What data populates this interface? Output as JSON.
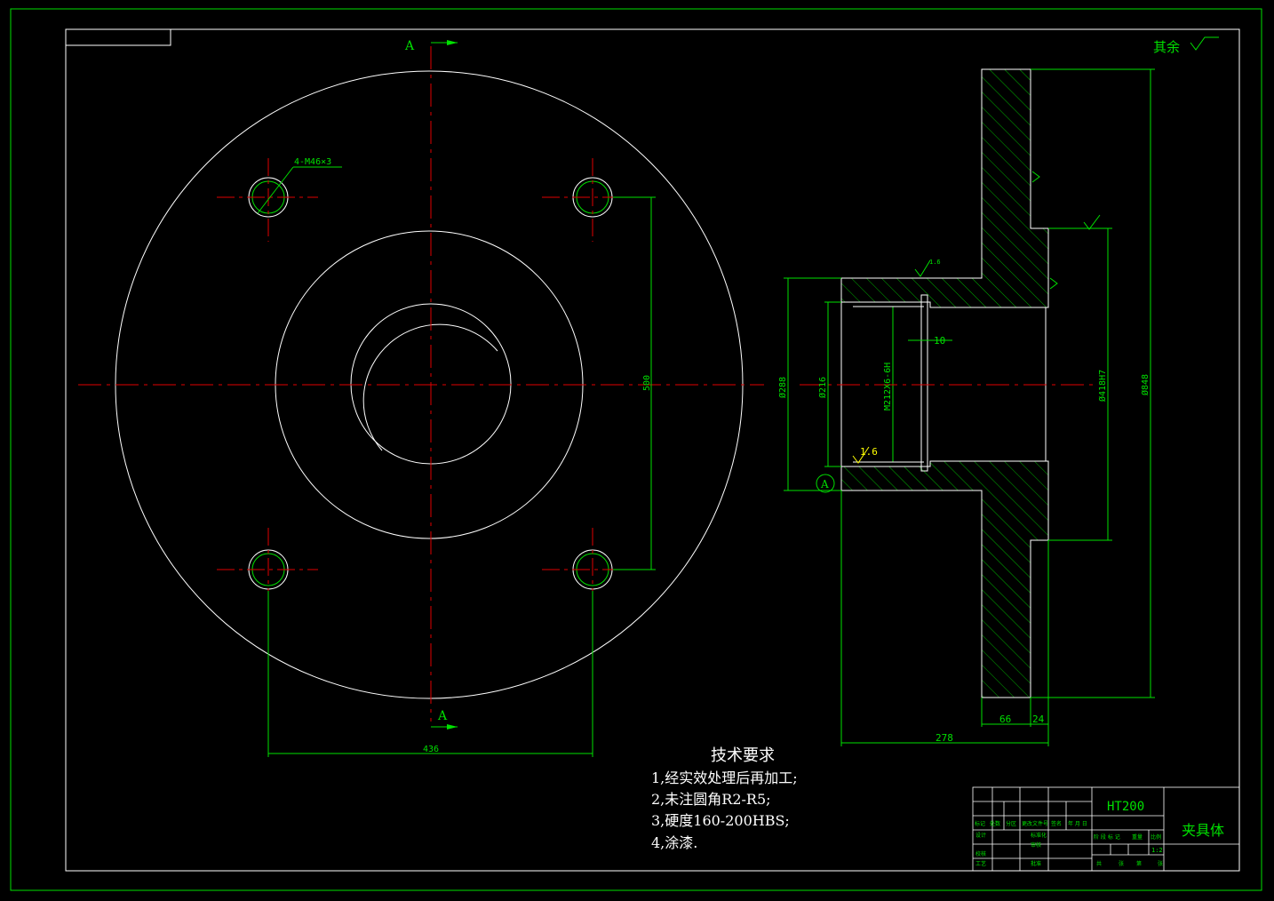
{
  "colors": {
    "background": "#000000",
    "outline": "#ffffff",
    "center_line": "#e00000",
    "dimension": "#00e000",
    "hatch": "#00c000",
    "highlight": "#ffff00"
  },
  "section_label": "A",
  "roughness_note": "其余",
  "hole_callout": "4-M46×3",
  "dimensions": {
    "bolt_pitch_vertical": "500",
    "bolt_pitch_horizontal": "436",
    "dia_288": "Ø288",
    "dia_216": "Ø216",
    "thread": "M212X6-6H",
    "groove_width": "10",
    "dia_418": "Ø418H7",
    "dia_848": "Ø848",
    "flange_66": "66",
    "flange_24": "24",
    "length_278": "278",
    "roughness_value": "1.6",
    "roughness_small": "1.6"
  },
  "datum_label": "A",
  "tech_requirements": {
    "title": "技术要求",
    "items": [
      "1,经实效处理后再加工;",
      "2,未注圆角R2-R5;",
      "3,硬度160-200HBS;",
      "4,涂漆."
    ]
  },
  "title_block": {
    "material": "HT200",
    "part_name": "夹具体",
    "scale": "1:2",
    "headers_row1": [
      "标记",
      "处数",
      "分区",
      "更改文件号",
      "签名",
      "年 月 日"
    ],
    "row_design": [
      "设计",
      "标准化"
    ],
    "row_review": [
      "审核"
    ],
    "row_check": [
      "校核"
    ],
    "row_process": [
      "工艺",
      "批准"
    ],
    "right_headers": [
      "阶 段 标 记",
      "重量",
      "比例"
    ],
    "sheet_info": [
      "共",
      "张",
      "第",
      "张"
    ]
  }
}
